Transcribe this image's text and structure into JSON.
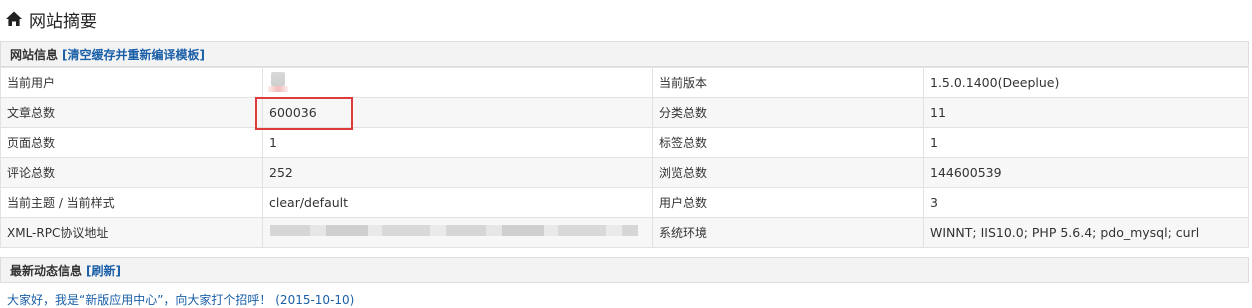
{
  "page": {
    "title": "网站摘要",
    "icon": "home-icon"
  },
  "site_info": {
    "heading": "网站信息",
    "action_link": "[清空缓存并重新编译模板]",
    "rows": [
      {
        "k1": "当前用户",
        "v1": "",
        "k2": "当前版本",
        "v2": "1.5.0.1400(Deeplue)"
      },
      {
        "k1": "文章总数",
        "v1": "600036",
        "k2": "分类总数",
        "v2": "11"
      },
      {
        "k1": "页面总数",
        "v1": "1",
        "k2": "标签总数",
        "v2": "1"
      },
      {
        "k1": "评论总数",
        "v1": "252",
        "k2": "浏览总数",
        "v2": "144600539"
      },
      {
        "k1": "当前主题 / 当前样式",
        "v1": "clear/default",
        "k2": "用户总数",
        "v2": "3"
      },
      {
        "k1": "XML-RPC协议地址",
        "v1": "",
        "k2": "系统环境",
        "v2": "WINNT; IIS10.0; PHP 5.6.4; pdo_mysql; curl"
      }
    ]
  },
  "dynamic_info": {
    "heading": "最新动态信息",
    "action_link": "[刷新]",
    "items": [
      "大家好，我是“新版应用中心”，向大家打个招呼！ (2015-10-10)"
    ]
  },
  "colors": {
    "link": "#1a5fa8",
    "highlight": "#e03b3b"
  }
}
